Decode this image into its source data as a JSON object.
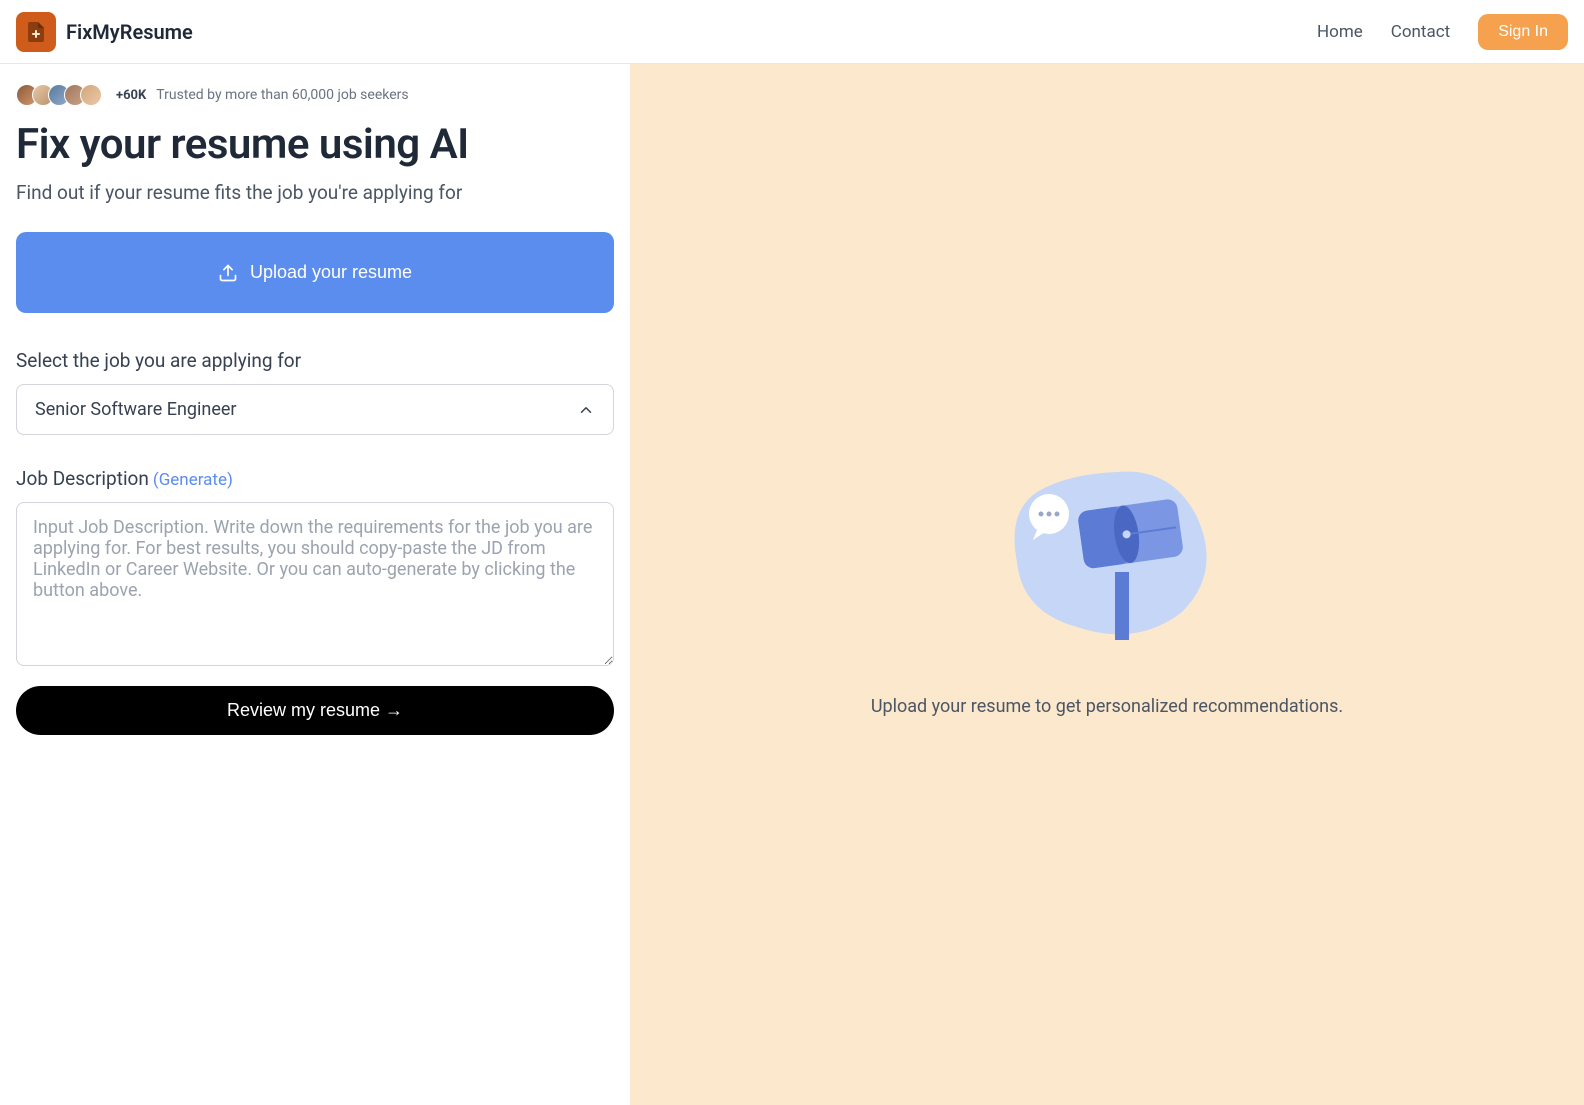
{
  "header": {
    "brand": "FixMyResume",
    "nav": {
      "home": "Home",
      "contact": "Contact",
      "signin": "Sign In"
    }
  },
  "trust": {
    "count": "+60K",
    "text": "Trusted by more than 60,000 job seekers"
  },
  "hero": {
    "title": "Fix your resume using AI",
    "subtitle": "Find out if your resume fits the job you're applying for"
  },
  "upload": {
    "label": "Upload your resume"
  },
  "job_select": {
    "label": "Select the job you are applying for",
    "value": "Senior Software Engineer"
  },
  "job_description": {
    "label": "Job Description",
    "generate": "(Generate)",
    "placeholder": "Input Job Description. Write down the requirements for the job you are applying for. For best results, you should copy-paste the JD from LinkedIn or Career Website. Or you can auto-generate by clicking the button above."
  },
  "review": {
    "label": "Review my resume →"
  },
  "right": {
    "message": "Upload your resume to get personalized recommendations."
  }
}
